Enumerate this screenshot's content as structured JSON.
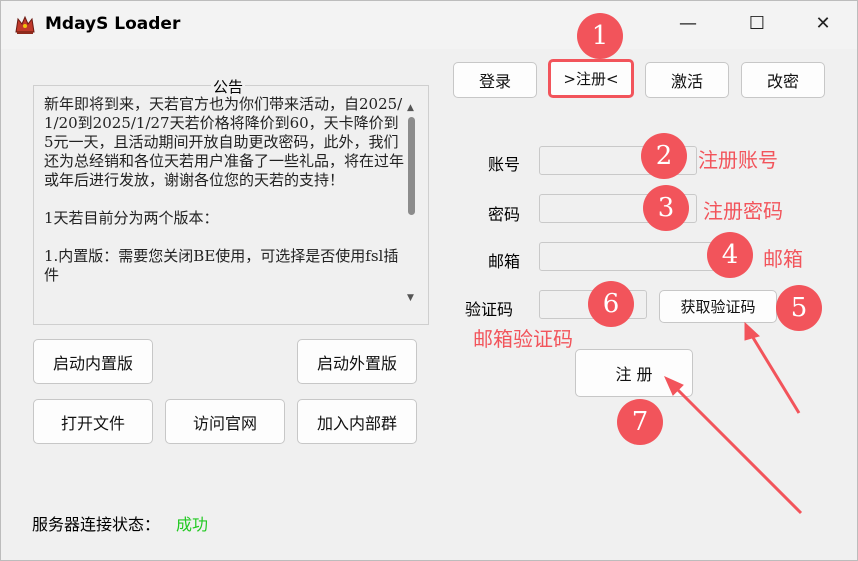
{
  "window": {
    "title": "MdayS Loader",
    "minimize_glyph": "—",
    "maximize_glyph": "☐",
    "close_glyph": "✕"
  },
  "tabs": [
    {
      "label": "登录"
    },
    {
      "label": ">注册<",
      "active": true
    },
    {
      "label": "激活"
    },
    {
      "label": "改密"
    }
  ],
  "notice": {
    "title": "公告",
    "text": "新年即将到来，天若官方也为你们带来活动，自2025/1/20到2025/1/27天若价格将降价到60，天卡降价到5元一天，且活动期间开放自助更改密码，此外，我们还为总经销和各位天若用户准备了一些礼品，将在过年或年后进行发放，谢谢各位您的天若的支持！\n\n1天若目前分为两个版本：\n\n1.内置版：需要您关闭BE使用，可选择是否使用fsl插件"
  },
  "form": {
    "account_label": "账号",
    "account_value": "",
    "password_label": "密码",
    "password_value": "",
    "email_label": "邮箱",
    "email_value": "",
    "code_label": "验证码",
    "code_value": "",
    "get_code_button": "获取验证码",
    "register_button": "注 册"
  },
  "buttons": {
    "launch_internal": "启动内置版",
    "launch_external": "启动外置版",
    "open_file": "打开文件",
    "visit_site": "访问官网",
    "join_group": "加入内部群"
  },
  "status": {
    "label": "服务器连接状态：",
    "value": "成功",
    "value_color": "#22c922"
  },
  "annotations": {
    "accent_color": "#f2545b",
    "badges": [
      "1",
      "2",
      "3",
      "4",
      "5",
      "6",
      "7"
    ],
    "register_account": "注册账号",
    "register_password": "注册密码",
    "email": "邮箱",
    "email_code": "邮箱验证码"
  }
}
